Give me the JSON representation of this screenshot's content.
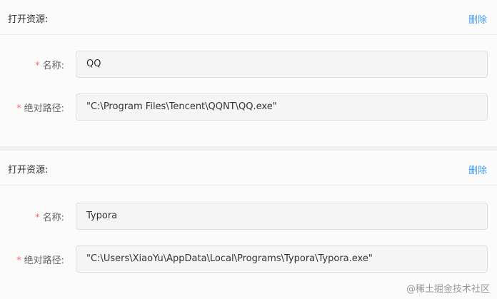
{
  "resources": [
    {
      "title": "打开资源:",
      "delete_label": "删除",
      "name_label": "名称:",
      "name_value": "QQ",
      "path_label": "绝对路径:",
      "path_value": "\"C:\\Program Files\\Tencent\\QQNT\\QQ.exe\""
    },
    {
      "title": "打开资源:",
      "delete_label": "删除",
      "name_label": "名称:",
      "name_value": "Typora",
      "path_label": "绝对路径:",
      "path_value": "\"C:\\Users\\XiaoYu\\AppData\\Local\\Programs\\Typora\\Typora.exe\""
    }
  ],
  "required_mark": "*",
  "watermark": "@稀土掘金技术社区",
  "colors": {
    "accent": "#409eff",
    "required": "#f56c6c"
  }
}
